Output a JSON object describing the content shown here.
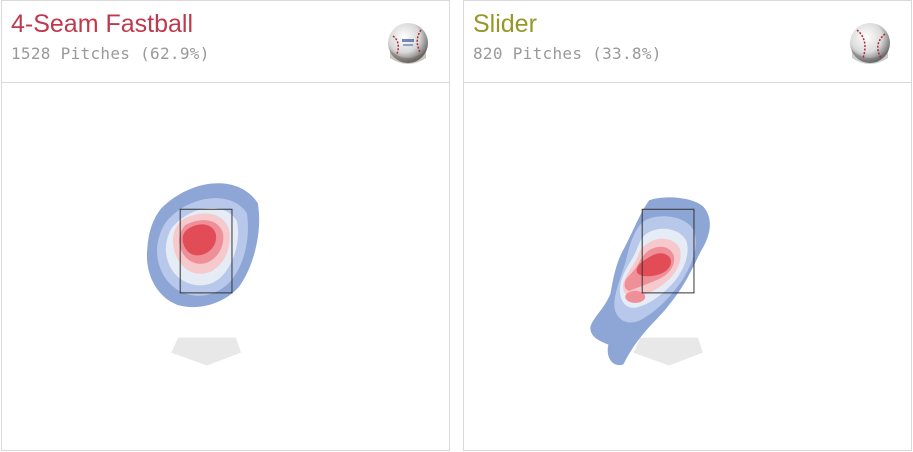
{
  "cards": [
    {
      "name": "4-Seam Fastball",
      "count_text": "1528 Pitches (62.9%)",
      "color": "#c0384c",
      "icon": "baseball-fourseam-icon"
    },
    {
      "name": "Slider",
      "count_text": "820 Pitches (33.8%)",
      "color": "#979728",
      "icon": "baseball-slider-icon"
    }
  ],
  "chart_data": [
    {
      "type": "heatmap",
      "title": "4-Seam Fastball",
      "subtitle": "1528 Pitches (62.9%)",
      "pitches": 1528,
      "usage_pct": 62.9,
      "density_peak": {
        "horizontal_relative_to_zone_center": -0.15,
        "vertical_relative_to_zone_center": 0.2
      },
      "density_colors": [
        "#8ea6d6",
        "#b8c8ea",
        "#e6ecf6",
        "#ffffff",
        "#f6c9cd",
        "#ef8f97",
        "#e24c57"
      ],
      "strike_zone": true,
      "home_plate": true
    },
    {
      "type": "heatmap",
      "title": "Slider",
      "subtitle": "820 Pitches (33.8%)",
      "pitches": 820,
      "usage_pct": 33.8,
      "density_peak": {
        "horizontal_relative_to_zone_center": 0.1,
        "vertical_relative_to_zone_center": -0.3
      },
      "density_colors": [
        "#8ea6d6",
        "#b8c8ea",
        "#e6ecf6",
        "#ffffff",
        "#f6c9cd",
        "#ef8f97",
        "#e24c57"
      ],
      "strike_zone": true,
      "home_plate": true
    }
  ]
}
